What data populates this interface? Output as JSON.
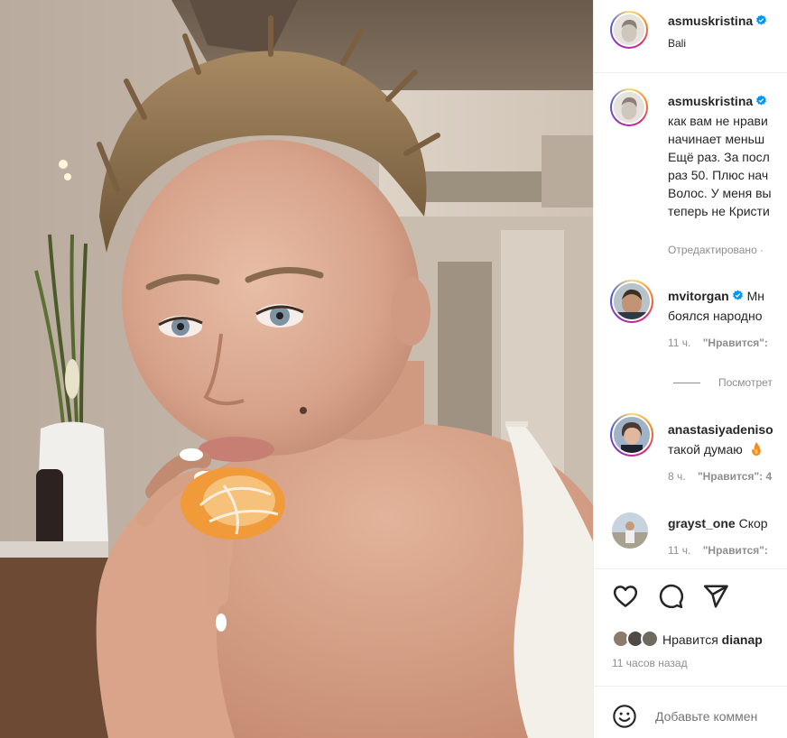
{
  "post": {
    "author": "asmuskristina",
    "location": "Bali"
  },
  "caption": {
    "author": "asmuskristina",
    "lines": [
      "как вам не нрави",
      "начинает меньш",
      "Ещё раз. За посл",
      "раз 50. Плюс нач",
      "Волос. У меня вы",
      "теперь не Кристи"
    ],
    "edited": "Отредактировано ·"
  },
  "comments": [
    {
      "user": "mvitorgan",
      "verified": true,
      "text": "Мн",
      "text2": "боялся народно",
      "time": "11 ч.",
      "likes": "\"Нравится\":"
    },
    {
      "user": "anastasiyadeniso",
      "verified": false,
      "text": "",
      "text2": "такой думаю",
      "time": "8 ч.",
      "likes": "\"Нравится\": 4"
    },
    {
      "user": "grayst_one",
      "verified": false,
      "text": "Скор",
      "text2": "",
      "time": "11 ч.",
      "likes": "\"Нравится\":"
    }
  ],
  "view_replies": "Посмотрет",
  "likes_bar": {
    "prefix": "Нравится",
    "user": "dianap"
  },
  "post_time": "11 часов назад",
  "comment_input": {
    "placeholder": "Добавьте коммен"
  },
  "icons": {
    "like": "heart-icon",
    "comment": "comment-icon",
    "share": "send-icon",
    "emoji": "smiley-icon",
    "verified": "verified-badge-icon"
  },
  "colors": {
    "verified": "#0095f6",
    "muted": "#8e8e8e",
    "text": "#262626",
    "divider": "#efefef"
  }
}
